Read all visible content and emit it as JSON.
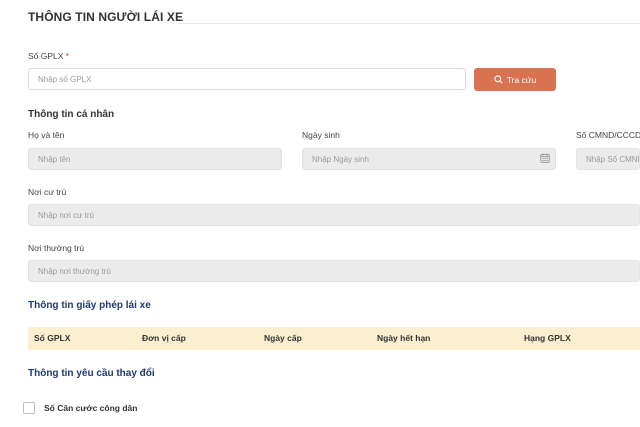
{
  "section": {
    "title": "THÔNG TIN NGƯỜI LÁI XE"
  },
  "license": {
    "label": "Số GPLX",
    "required_mark": "*",
    "placeholder": "Nhập số GPLX",
    "search_button": "Tra cứu"
  },
  "personal": {
    "heading": "Thông tin cá nhân",
    "name_label": "Họ và tên",
    "name_placeholder": "Nhập tên",
    "dob_label": "Ngày sinh",
    "dob_placeholder": "Nhập Ngày sinh",
    "id_label": "Số CMND/CCCD",
    "id_placeholder": "Nhập Số CMND/CCCD",
    "residence_label": "Nơi cư trú",
    "residence_placeholder": "Nhập nơi cư trú",
    "permanent_label": "Nơi thường trú",
    "permanent_placeholder": "Nhập nơi thường trú"
  },
  "license_info": {
    "heading": "Thông tin giấy phép lái xe",
    "columns": [
      "Số GPLX",
      "Đơn vị cấp",
      "Ngày cấp",
      "Ngày hết hạn",
      "Hạng GPLX"
    ]
  },
  "change_request": {
    "heading": "Thông tin yêu cầu thay đổi",
    "checkbox_label": "Số Căn cước công dân"
  },
  "colors": {
    "accent": "#d97250",
    "table_header": "#fbefcf",
    "heading_blue": "#1f3a6b"
  }
}
